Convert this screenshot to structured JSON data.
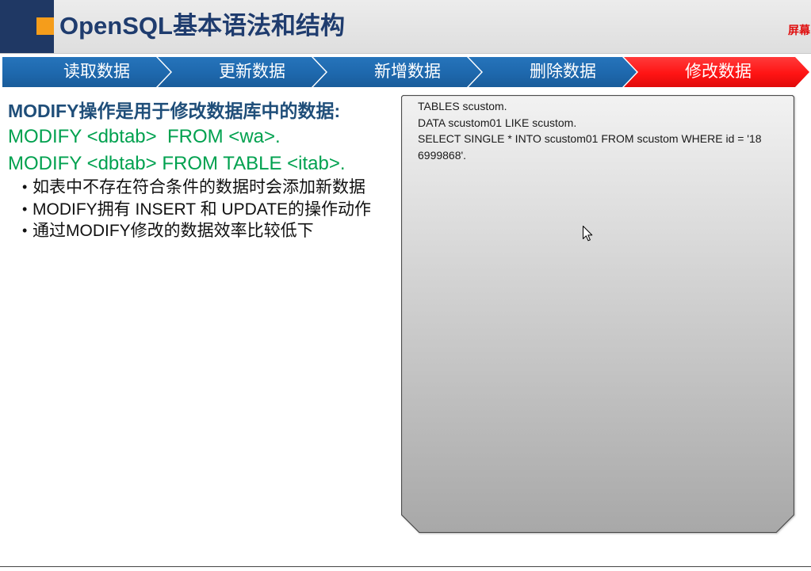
{
  "header": {
    "title": "OpenSQL基本语法和结构",
    "corner_text": "屏幕"
  },
  "nav": {
    "items": [
      {
        "label": "读取数据",
        "active": false
      },
      {
        "label": "更新数据",
        "active": false
      },
      {
        "label": "新增数据",
        "active": false
      },
      {
        "label": "删除数据",
        "active": false
      },
      {
        "label": "修改数据",
        "active": true
      }
    ]
  },
  "content": {
    "heading": "MODIFY操作是用于修改数据库中的数据:",
    "syntax": [
      "MODIFY <dbtab>  FROM <wa>.",
      "MODIFY <dbtab> FROM TABLE <itab>."
    ],
    "bullets": [
      "如表中不存在符合条件的数据时会添加新数据",
      "MODIFY拥有 INSERT 和 UPDATE的操作动作",
      "通过MODIFY修改的数据效率比较低下"
    ]
  },
  "code_panel": {
    "lines": [
      "TABLES scustom.",
      "DATA scustom01 LIKE scustom.",
      "SELECT SINGLE * INTO scustom01 FROM scustom WHERE id = '18",
      "6999868'."
    ]
  },
  "icons": {
    "cursor": "mouse-pointer-icon",
    "logo_accent": "orange-square-icon"
  },
  "colors": {
    "header_bg": "#dedede",
    "logo_block": "#1f3864",
    "logo_accent": "#f59d1b",
    "title": "#1f3c6e",
    "corner_text": "#e01010",
    "nav_inactive": "#1e68ad",
    "nav_active": "#ff1414",
    "heading": "#1f4e79",
    "syntax": "#00a14f",
    "body_text": "#111111",
    "panel_top": "#f2f2f2",
    "panel_bottom": "#a8a8a8",
    "panel_border": "#4d4d4d"
  }
}
